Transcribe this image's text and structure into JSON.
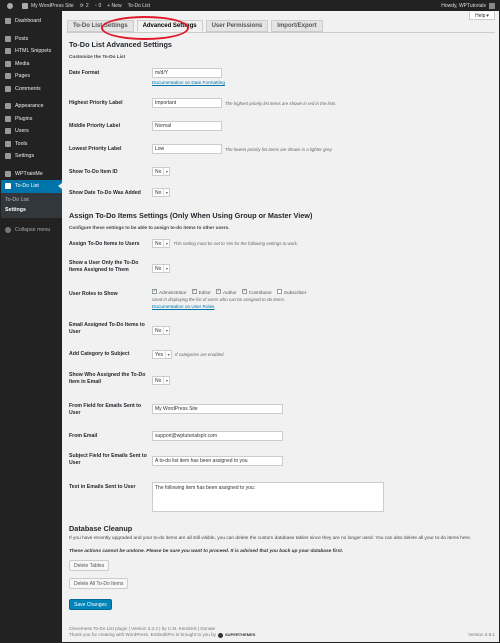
{
  "adminbar": {
    "site_name": "My WordPress Site",
    "updates": "2",
    "comments": "0",
    "new_label": "+ New",
    "plugin_label": "To-Do List",
    "howdy": "Howdy, WPTutorials"
  },
  "sidebar": {
    "items": [
      {
        "label": "Dashboard",
        "icon": "dashboard-icon"
      },
      {
        "label": "Posts",
        "icon": "pin-icon"
      },
      {
        "label": "HTML Snippets",
        "icon": "code-icon"
      },
      {
        "label": "Media",
        "icon": "media-icon"
      },
      {
        "label": "Pages",
        "icon": "page-icon"
      },
      {
        "label": "Comments",
        "icon": "comment-icon"
      },
      {
        "label": "Appearance",
        "icon": "brush-icon"
      },
      {
        "label": "Plugins",
        "icon": "plugin-icon"
      },
      {
        "label": "Users",
        "icon": "user-icon"
      },
      {
        "label": "Tools",
        "icon": "wrench-icon"
      },
      {
        "label": "Settings",
        "icon": "settings-icon"
      },
      {
        "label": "WPTrainMe",
        "icon": "wptrainme-icon"
      },
      {
        "label": "To-Do List",
        "icon": "checklist-icon"
      }
    ],
    "submenu": [
      "To-Do List",
      "Settings"
    ],
    "collapse": "Collapse menu"
  },
  "help": "Help",
  "tabs": [
    "To-Do List Settings",
    "Advanced Settings",
    "User Permissions",
    "Import/Export"
  ],
  "section1": {
    "title": "To-Do List Advanced Settings",
    "subtitle": "Customize the To-Do List",
    "date_format_label": "Date Format",
    "date_format_value": "m/d/Y",
    "date_format_link": "Documentation on Date Formatting",
    "highest_label": "Highest Priority Label",
    "highest_value": "Important",
    "highest_desc": "The highest priority list items are shown in red in the lists.",
    "middle_label": "Middle Priority Label",
    "middle_value": "Normal",
    "lowest_label": "Lowest Priority Label",
    "lowest_value": "Low",
    "lowest_desc": "The lowest priority list items are shown in a lighter grey.",
    "show_id_label": "Show To-Do Item ID",
    "show_id_value": "No",
    "show_date_label": "Show Date To-Do Was Added",
    "show_date_value": "No"
  },
  "section2": {
    "title": "Assign To-Do Items Settings (Only When Using Group or Master View)",
    "subtitle": "Configure these settings to be able to assign to-do items to other users.",
    "assign_label": "Assign To-Do Items to Users",
    "assign_value": "No",
    "assign_desc": "This setting must be set to Yes for the following settings to work.",
    "show_only_label": "Show a User Only the To-Do Items Assigned to Them",
    "show_only_value": "No",
    "roles_label": "User Roles to Show",
    "roles": [
      {
        "label": "Administrator",
        "checked": true
      },
      {
        "label": "Editor",
        "checked": true
      },
      {
        "label": "Author",
        "checked": true
      },
      {
        "label": "Contributor",
        "checked": true
      },
      {
        "label": "Subscriber",
        "checked": false
      }
    ],
    "roles_desc": "Used in displaying the list of users who can be assigned to-do items.",
    "roles_link": "Documentation on User Roles",
    "email_label": "Email Assigned To-Do Items to User",
    "email_value": "No",
    "category_label": "Add Category to Subject",
    "category_value": "Yes",
    "category_desc": "If categories are enabled.",
    "show_who_label": "Show Who Assigned the To-Do Item in Email",
    "show_who_value": "No",
    "from_field_label": "From Field for Emails Sent to User",
    "from_field_value": "My WordPress Site",
    "from_email_label": "From Email",
    "from_email_value": "support@wptutorialspIr.com",
    "subject_label": "Subject Field for Emails Sent to User",
    "subject_value": "A to-do list item has been assigned to you",
    "text_label": "Text in Emails Sent to User",
    "text_value": "The following item has been assigned to you:"
  },
  "section3": {
    "title": "Database Cleanup",
    "para": "If you have recently upgraded and your to-do items are all still visible, you can delete the custom database tables since they are no longer used. You can also delete all your to-do items here.",
    "warning": "These actions cannot be undone. Please be sure you want to proceed. It is advised that you back up your database first.",
    "delete_tables": "Delete Tables",
    "delete_items": "Delete All To-Do Items",
    "save": "Save Changes"
  },
  "footer": {
    "line1": "Cleverness To-Do List plugin | Version 3.3.2 | by C.M. Kendrick | Donate",
    "line2": "Thank you for creating with WordPress. EmbeditPro is brought to you by",
    "brand": "SUPERTHEMES",
    "version": "Version 3.9.1"
  }
}
